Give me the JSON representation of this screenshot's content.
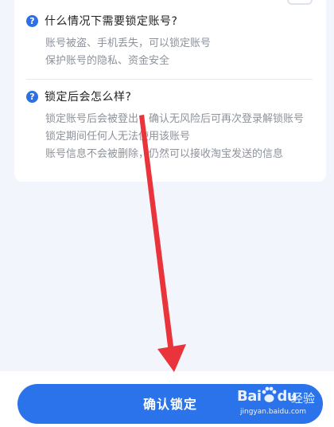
{
  "faqs": [
    {
      "title": "什么情况下需要锁定账号?",
      "lines": [
        "账号被盗、手机丢失，可以锁定账号",
        "保护账号的隐私、资金安全"
      ]
    },
    {
      "title": "锁定后会怎么样?",
      "lines": [
        "锁定账号后会被登出，确认无风险后可再次登录解锁账号",
        "锁定期间任何人无法使用该账号",
        "账号信息不会被删除，仍然可以接收淘宝发送的信息"
      ]
    }
  ],
  "question_icon": "?",
  "confirm_button": "确认锁定",
  "watermark": {
    "brand_left": "Bai",
    "brand_right": "du",
    "service": "经验",
    "url": "jingyan.baidu.com"
  },
  "colors": {
    "accent": "#2b73ea",
    "background": "#f2f5fb",
    "annotation_arrow": "#e8343a"
  }
}
